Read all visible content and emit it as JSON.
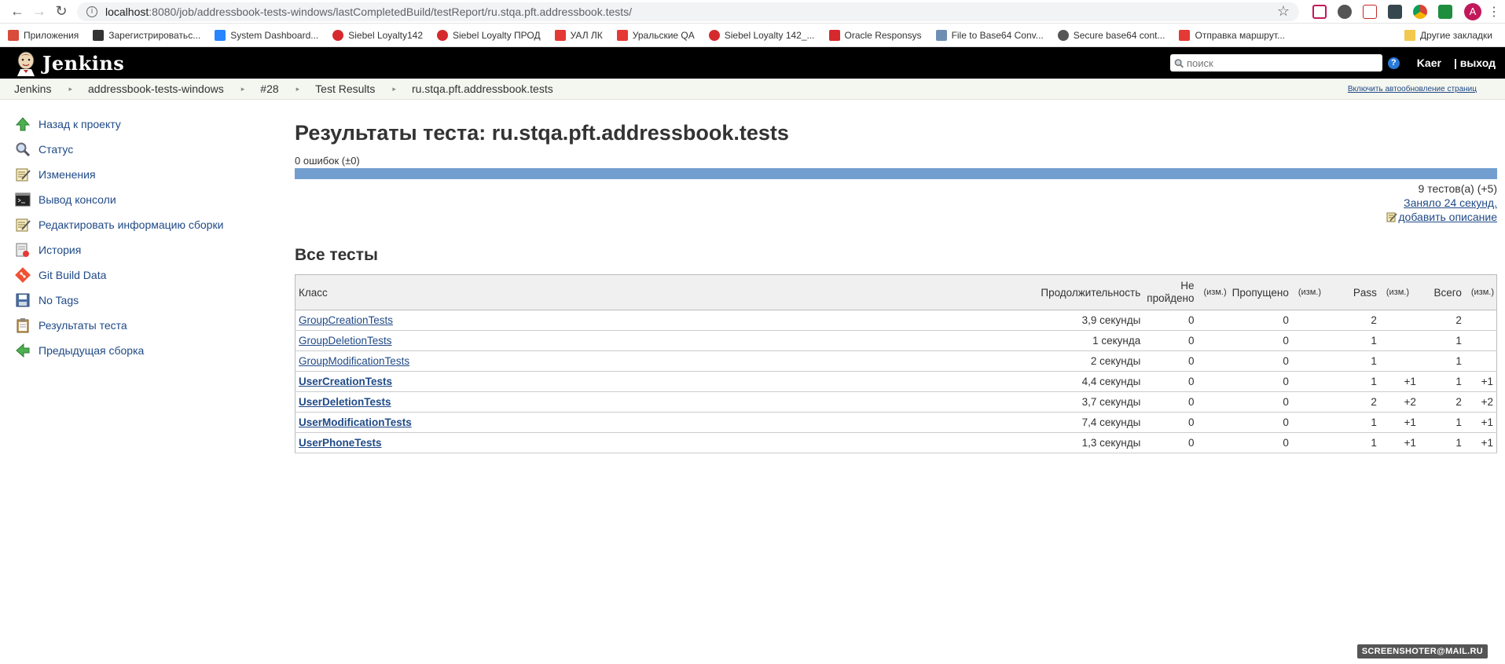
{
  "browser": {
    "url_host": "localhost",
    "url_path": ":8080/job/addressbook-tests-windows/lastCompletedBuild/testReport/ru.stqa.pft.addressbook.tests/",
    "avatar_letter": "A"
  },
  "bookmarks": [
    {
      "label": "Приложения",
      "icon": "apps-grid-icon",
      "color": "#d94b3a"
    },
    {
      "label": "Зарегистрироватьс...",
      "icon": "tools-icon",
      "color": "#333333"
    },
    {
      "label": "System Dashboard...",
      "icon": "jira-icon",
      "color": "#2684ff"
    },
    {
      "label": "Siebel Loyalty142",
      "icon": "oracle-icon",
      "color": "#d6292e"
    },
    {
      "label": "Siebel Loyalty ПРОД",
      "icon": "oracle-icon",
      "color": "#d6292e"
    },
    {
      "label": "УАЛ ЛК",
      "icon": "ural-icon",
      "color": "#e53935"
    },
    {
      "label": "Уральские  QA",
      "icon": "ural-icon",
      "color": "#e53935"
    },
    {
      "label": "Siebel Loyalty 142_...",
      "icon": "oracle-icon",
      "color": "#d6292e"
    },
    {
      "label": "Oracle Responsys",
      "icon": "oracle-square-icon",
      "color": "#d6292e"
    },
    {
      "label": "File to Base64 Conv...",
      "icon": "cloud-icon",
      "color": "#6d8fb3"
    },
    {
      "label": "Secure base64 cont...",
      "icon": "globe-icon",
      "color": "#555555"
    },
    {
      "label": "Отправка маршрут...",
      "icon": "ural-icon",
      "color": "#e53935"
    }
  ],
  "bookmarks_other": "Другие закладки",
  "header": {
    "brand": "Jenkins",
    "search_placeholder": "поиск",
    "user": "Kaer",
    "logout": "| выход"
  },
  "breadcrumbs": [
    "Jenkins",
    "addressbook-tests-windows",
    "#28",
    "Test Results",
    "ru.stqa.pft.addressbook.tests"
  ],
  "autorefresh": "Включить автообновление страниц",
  "sidebar": [
    {
      "label": "Назад к проекту",
      "icon": "up-arrow-icon"
    },
    {
      "label": "Статус",
      "icon": "magnifier-icon"
    },
    {
      "label": "Изменения",
      "icon": "notepad-icon"
    },
    {
      "label": "Вывод консоли",
      "icon": "terminal-icon"
    },
    {
      "label": "Редактировать информацию сборки",
      "icon": "notepad-icon"
    },
    {
      "label": "История",
      "icon": "history-icon"
    },
    {
      "label": "Git Build Data",
      "icon": "git-icon"
    },
    {
      "label": "No Tags",
      "icon": "save-icon"
    },
    {
      "label": "Результаты теста",
      "icon": "clipboard-icon"
    },
    {
      "label": "Предыдущая сборка",
      "icon": "left-arrow-icon"
    }
  ],
  "main": {
    "title": "Результаты теста: ru.stqa.pft.addressbook.tests",
    "failures": "0 ошибок (±0)",
    "pass_fraction": 1.0,
    "test_count": "9 тестов(а) (+5)",
    "duration": "Заняло 24 секунд.",
    "add_description": "добавить описание",
    "all_tests": "Все тесты"
  },
  "table": {
    "headers": {
      "class": "Класс",
      "duration": "Продолжительность",
      "failed": "Не пройдено",
      "skipped": "Пропущено",
      "pass": "Pass",
      "total": "Всего",
      "diff": "(изм.)"
    },
    "rows": [
      {
        "name": "GroupCreationTests",
        "duration": "3,9 секунды",
        "failed": "0",
        "failed_diff": "",
        "skipped": "0",
        "skipped_diff": "",
        "pass": "2",
        "pass_diff": "",
        "total": "2",
        "total_diff": "",
        "bold": false
      },
      {
        "name": "GroupDeletionTests",
        "duration": "1 секунда",
        "failed": "0",
        "failed_diff": "",
        "skipped": "0",
        "skipped_diff": "",
        "pass": "1",
        "pass_diff": "",
        "total": "1",
        "total_diff": "",
        "bold": false
      },
      {
        "name": "GroupModificationTests",
        "duration": "2 секунды",
        "failed": "0",
        "failed_diff": "",
        "skipped": "0",
        "skipped_diff": "",
        "pass": "1",
        "pass_diff": "",
        "total": "1",
        "total_diff": "",
        "bold": false
      },
      {
        "name": "UserCreationTests",
        "duration": "4,4 секунды",
        "failed": "0",
        "failed_diff": "",
        "skipped": "0",
        "skipped_diff": "",
        "pass": "1",
        "pass_diff": "+1",
        "total": "1",
        "total_diff": "+1",
        "bold": true
      },
      {
        "name": "UserDeletionTests",
        "duration": "3,7 секунды",
        "failed": "0",
        "failed_diff": "",
        "skipped": "0",
        "skipped_diff": "",
        "pass": "2",
        "pass_diff": "+2",
        "total": "2",
        "total_diff": "+2",
        "bold": true
      },
      {
        "name": "UserModificationTests",
        "duration": "7,4 секунды",
        "failed": "0",
        "failed_diff": "",
        "skipped": "0",
        "skipped_diff": "",
        "pass": "1",
        "pass_diff": "+1",
        "total": "1",
        "total_diff": "+1",
        "bold": true
      },
      {
        "name": "UserPhoneTests",
        "duration": "1,3 секунды",
        "failed": "0",
        "failed_diff": "",
        "skipped": "0",
        "skipped_diff": "",
        "pass": "1",
        "pass_diff": "+1",
        "total": "1",
        "total_diff": "+1",
        "bold": true
      }
    ]
  },
  "watermark": "SCREENSHOTER@MAIL.RU",
  "colors": {
    "link": "#204a87",
    "pass_bar": "#729fcf",
    "header_bg": "#000000"
  }
}
